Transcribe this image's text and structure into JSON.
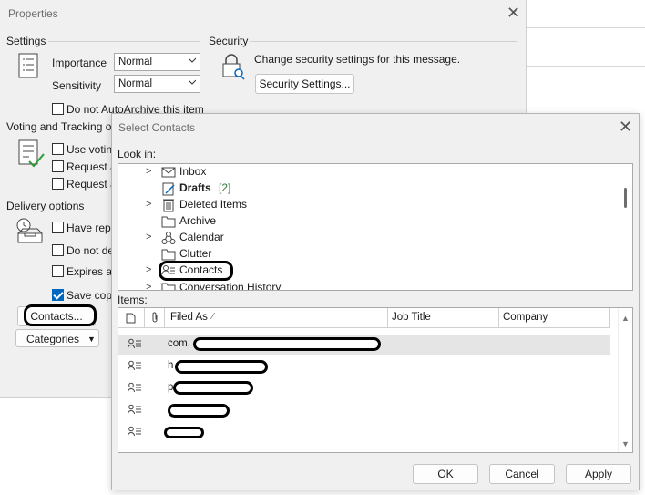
{
  "properties": {
    "title": "Properties",
    "settings": {
      "heading": "Settings",
      "importance_label": "Importance",
      "importance_value": "Normal",
      "sensitivity_label": "Sensitivity",
      "sensitivity_value": "Normal",
      "autoarchive_label": "Do not AutoArchive this item"
    },
    "security": {
      "heading": "Security",
      "description": "Change security settings for this message.",
      "button_label": "Security Settings..."
    },
    "voting": {
      "heading": "Voting and Tracking op",
      "opt1": "Use votin",
      "opt2": "Request a",
      "opt3": "Request a"
    },
    "delivery": {
      "heading": "Delivery options",
      "opt1": "Have repl",
      "opt2": "Do not de",
      "opt3": "Expires af",
      "opt4": "Save copy"
    },
    "contacts_button": "Contacts...",
    "categories_button": "Categories"
  },
  "select_contacts": {
    "title": "Select Contacts",
    "look_in_label": "Look in:",
    "folders": [
      {
        "label": "Inbox",
        "count": "",
        "bold": false,
        "expandable": true
      },
      {
        "label": "Drafts",
        "count": "[2]",
        "bold": true,
        "expandable": false
      },
      {
        "label": "Deleted Items",
        "count": "",
        "bold": false,
        "expandable": true
      },
      {
        "label": "Archive",
        "count": "",
        "bold": false,
        "expandable": false
      },
      {
        "label": "Calendar",
        "count": "",
        "bold": false,
        "expandable": true
      },
      {
        "label": "Clutter",
        "count": "",
        "bold": false,
        "expandable": false
      },
      {
        "label": "Contacts",
        "count": "",
        "bold": false,
        "expandable": true
      },
      {
        "label": "Conversation History",
        "count": "",
        "bold": false,
        "expandable": true
      }
    ],
    "items_label": "Items:",
    "columns": {
      "filed_as": "Filed As",
      "job_title": "Job Title",
      "company": "Company"
    },
    "rows": [
      {
        "filed_as": "com,",
        "selected": true
      },
      {
        "filed_as": "h",
        "selected": false
      },
      {
        "filed_as": "p",
        "selected": false
      },
      {
        "filed_as": "",
        "selected": false
      },
      {
        "filed_as": "",
        "selected": false
      }
    ],
    "ok_button": "OK",
    "cancel_button": "Cancel",
    "apply_button": "Apply"
  },
  "colors": {
    "accent": "#0067c0",
    "drafts_count": "#2e7d32"
  }
}
